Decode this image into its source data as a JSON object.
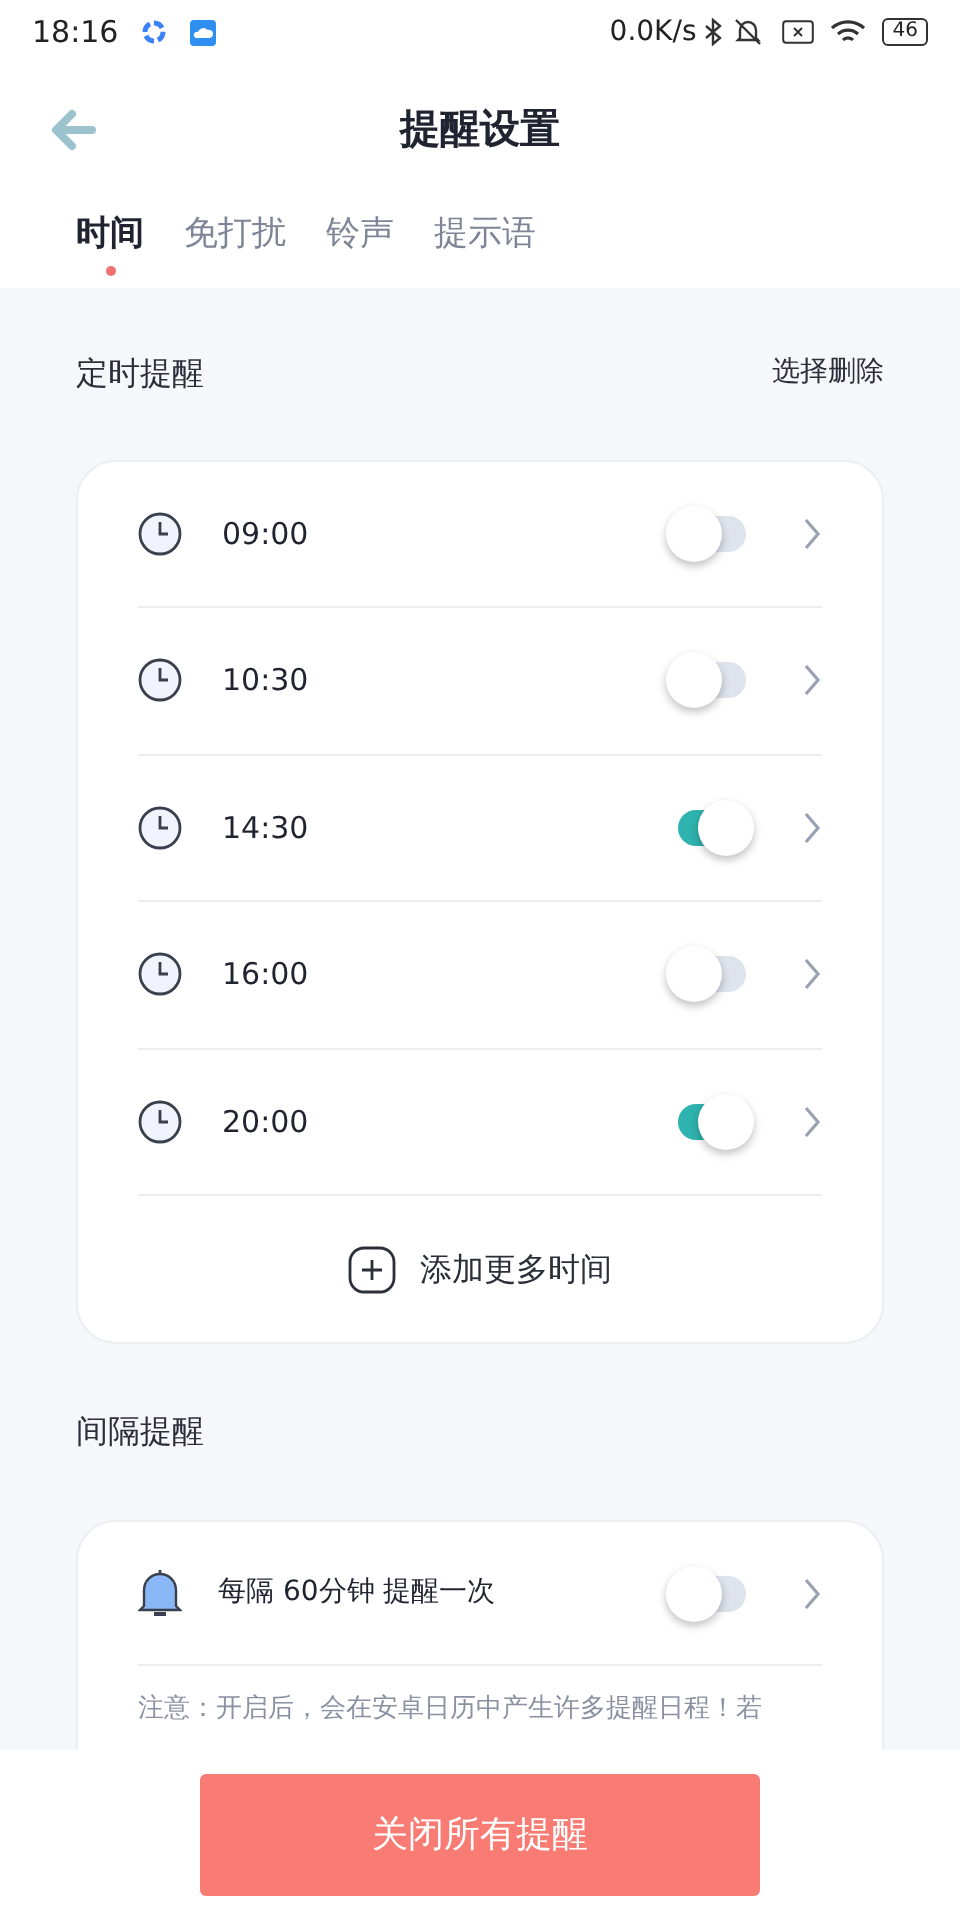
{
  "status_bar": {
    "time": "18:16",
    "net_speed": "0.0K/s",
    "battery": "46"
  },
  "header": {
    "title": "提醒设置"
  },
  "tabs": [
    {
      "label": "时间",
      "selected": true
    },
    {
      "label": "免打扰",
      "selected": false
    },
    {
      "label": "铃声",
      "selected": false
    },
    {
      "label": "提示语",
      "selected": false
    }
  ],
  "timed_section": {
    "title": "定时提醒",
    "action": "选择删除",
    "items": [
      {
        "time": "09:00",
        "on": false
      },
      {
        "time": "10:30",
        "on": false
      },
      {
        "time": "14:30",
        "on": true
      },
      {
        "time": "16:00",
        "on": false
      },
      {
        "time": "20:00",
        "on": true
      }
    ],
    "add_label": "添加更多时间"
  },
  "interval_section": {
    "title": "间隔提醒",
    "label": "每隔 60分钟 提醒一次",
    "on": false,
    "note": "注意：开启后，会在安卓日历中产生许多提醒日程！若"
  },
  "bottom_button": "关闭所有提醒"
}
